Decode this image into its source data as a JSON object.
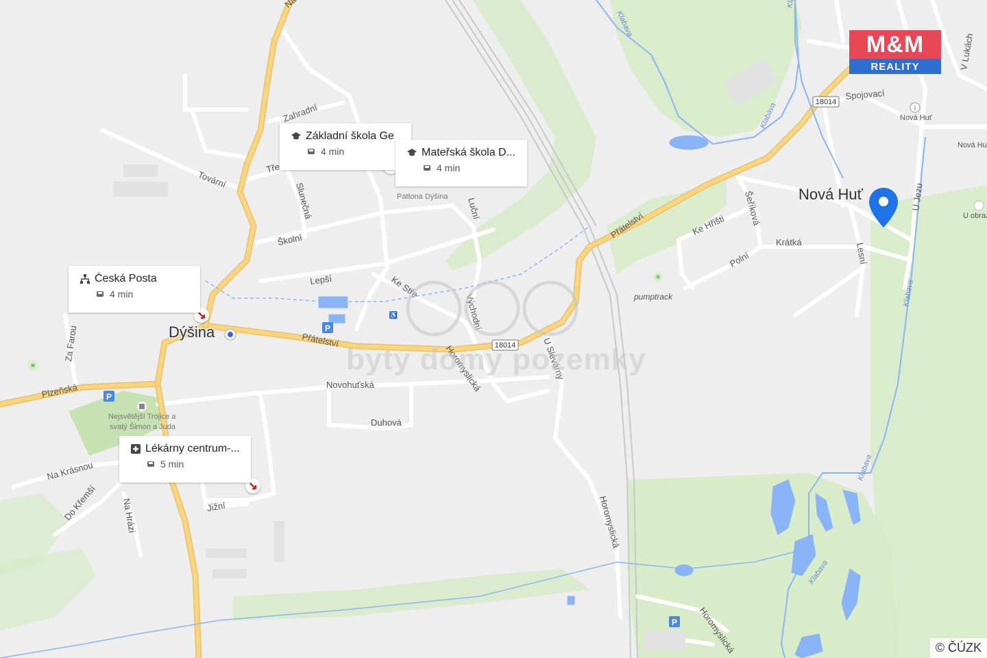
{
  "map": {
    "town_labels": {
      "dysina": "Dýšina",
      "nova_hut": "Nová Huť"
    },
    "street_labels": {
      "nadrazni": "Nádražní",
      "zahradni": "Zahradní",
      "tovarni": "Tovární",
      "tr": "Tře",
      "slunecna": "Slunečná",
      "skolni": "Školní",
      "lepsi": "Lepší",
      "ke_stre": "Ke Stře",
      "lucni": "Luční",
      "vychodni": "Východní",
      "pratelstvi_1": "Přátelství",
      "pratelstvi_2": "Přátelství",
      "horomyslicka_1": "Horomyslická",
      "horomyslicka_2": "Horomyslická",
      "horomyslicka_3": "Horomyslická",
      "u_slevarny": "U Slévárny",
      "novohutska": "Novohuťská",
      "duhova": "Duhová",
      "plzenska": "Plzeňská",
      "za_farou": "Za Farou",
      "na_krasnou": "Na Krásnou",
      "do_kremsi": "Do Křemší",
      "na_hrazi": "Na Hrázi",
      "jizni": "Jižní",
      "ke_hristi": "Ke Hřišti",
      "serikova": "Šeříková",
      "kratka": "Krátká",
      "polni": "Polní",
      "lesni": "Lesní",
      "u_jezu": "U Jezu",
      "spojovaci": "Spojovací",
      "v_lukach": "V Lukách",
      "nova_hut_small_1": "Nová Huť",
      "nova_hut_small_2": "Nová Hut",
      "u_obraz": "U obraz",
      "klabava_1": "Klabava",
      "klabava_2": "Klabava",
      "klabava_3": "Klabava",
      "klabava_4": "Klabava",
      "klabava_5": "Klabava",
      "klabava_6": "Klabava",
      "pumptrack": "pumptrack",
      "patton_line1": "Pattona Dýšina",
      "kostel_line1": "Nejsvětější Trojice a",
      "kostel_line2": "svatý Šimon a Juda"
    },
    "road_numbers": {
      "r1": "18014",
      "r2": "18014"
    },
    "colors": {
      "background": "#eeeeee",
      "main_road": "#f8d57e",
      "minor_road": "#ffffff",
      "green": "#d6ebc6",
      "water": "#8ab4f8",
      "pin": "#1e73e8"
    }
  },
  "cards": [
    {
      "icon": "school-icon",
      "title": "Základní škola Ge",
      "time": "4 min"
    },
    {
      "icon": "school-icon",
      "title": "Mateřská škola D...",
      "time": "4 min"
    },
    {
      "icon": "post-office-icon",
      "title": "Česká Posta",
      "time": "4 min"
    },
    {
      "icon": "pharmacy-icon",
      "title": "Lékárny centrum-...",
      "time": "5 min"
    }
  ],
  "branding": {
    "logo_top": "M&M",
    "logo_bottom": "REALITY",
    "watermark": "byty domy pozemky",
    "copyright": "© ČÚZK"
  }
}
